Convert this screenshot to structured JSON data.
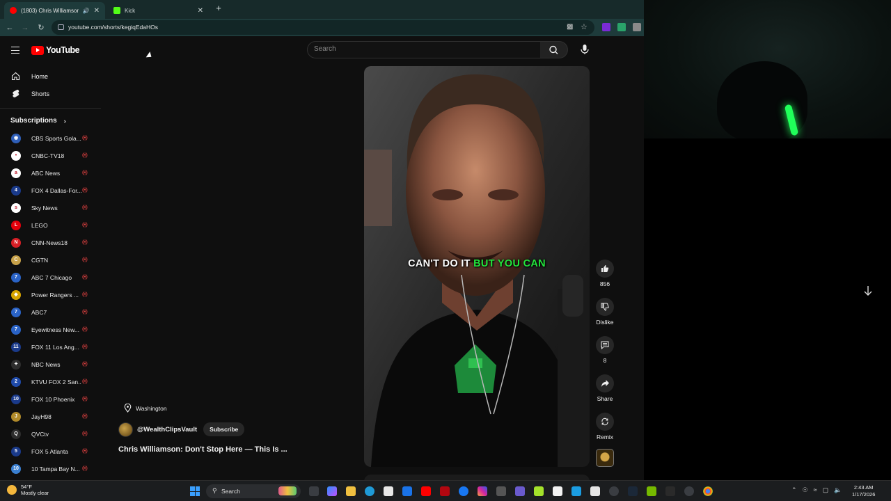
{
  "tabs": [
    {
      "title": "(1803) Chris Williamson: Do",
      "active": true
    },
    {
      "title": "Kick",
      "active": false
    }
  ],
  "address_bar": {
    "url": "youtube.com/shorts/kegiqEdaHOs"
  },
  "youtube": {
    "logo": "YouTube",
    "search_placeholder": "Search"
  },
  "sidebar": {
    "main": [
      {
        "label": "Home",
        "icon": "home-icon"
      },
      {
        "label": "Shorts",
        "icon": "shorts-icon"
      }
    ],
    "subscriptions_heading": "Subscriptions",
    "subscriptions": [
      {
        "name": "CBS Sports Gola...",
        "color": "#2f5fb8",
        "glyph": "◉"
      },
      {
        "name": "CNBC-TV18",
        "color": "#ffffff",
        "glyph": "•"
      },
      {
        "name": "ABC News",
        "color": "#ffffff",
        "glyph": "a"
      },
      {
        "name": "FOX 4 Dallas-For...",
        "color": "#1a3a8a",
        "glyph": "4"
      },
      {
        "name": "Sky News",
        "color": "#ffffff",
        "glyph": "s"
      },
      {
        "name": "LEGO",
        "color": "#e3000b",
        "glyph": "L"
      },
      {
        "name": "CNN-News18",
        "color": "#d71f26",
        "glyph": "N"
      },
      {
        "name": "CGTN",
        "color": "#c8a24a",
        "glyph": "C"
      },
      {
        "name": "ABC 7 Chicago",
        "color": "#2a63c6",
        "glyph": "7"
      },
      {
        "name": "Power Rangers ...",
        "color": "#d6a300",
        "glyph": "◆"
      },
      {
        "name": "ABC7",
        "color": "#2a63c6",
        "glyph": "7"
      },
      {
        "name": "Eyewitness New...",
        "color": "#2a63c6",
        "glyph": "7"
      },
      {
        "name": "FOX 11 Los Ang...",
        "color": "#1a3a8a",
        "glyph": "11"
      },
      {
        "name": "NBC News",
        "color": "#2d2d2d",
        "glyph": "✦"
      },
      {
        "name": "KTVU FOX 2 San...",
        "color": "#1f4aa8",
        "glyph": "2"
      },
      {
        "name": "FOX 10 Phoenix",
        "color": "#1a3a8a",
        "glyph": "10"
      },
      {
        "name": "JayH98",
        "color": "#b08a2a",
        "glyph": "J"
      },
      {
        "name": "QVCtv",
        "color": "#2d2d2d",
        "glyph": "Q"
      },
      {
        "name": "FOX 5 Atlanta",
        "color": "#1a3a8a",
        "glyph": "5"
      },
      {
        "name": "10 Tampa Bay N...",
        "color": "#3a7fd0",
        "glyph": "10"
      }
    ]
  },
  "short": {
    "caption_white": "CAN'T DO IT",
    "caption_green": "BUT YOU CAN",
    "location": "Washington",
    "channel": "@WealthClipsVault",
    "subscribe": "Subscribe",
    "title": "Chris Williamson: Don't Stop Here — This Is ...",
    "actions": {
      "likes": "856",
      "dislike": "Dislike",
      "comments": "8",
      "share": "Share",
      "remix": "Remix"
    }
  },
  "taskbar": {
    "temperature": "54°F",
    "weather": "Mostly clear",
    "search": "Search",
    "time": "2:43 AM",
    "date": "1/17/2026"
  }
}
